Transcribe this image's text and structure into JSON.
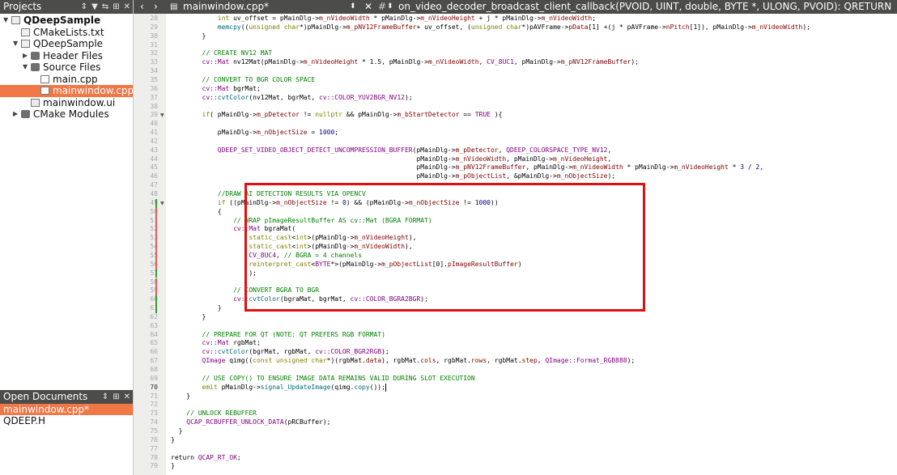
{
  "sidebar": {
    "header": "Projects",
    "tree": [
      {
        "label": "QDeepSample",
        "depth": 0,
        "icon": "project-icon",
        "arrow": "down",
        "bold": true
      },
      {
        "label": "CMakeLists.txt",
        "depth": 1,
        "icon": "file-icon",
        "arrow": "",
        "bold": false
      },
      {
        "label": "QDeepSample",
        "depth": 1,
        "icon": "hammer-icon",
        "arrow": "down",
        "bold": false
      },
      {
        "label": "Header Files",
        "depth": 2,
        "icon": "folder-icon",
        "arrow": "right",
        "bold": false
      },
      {
        "label": "Source Files",
        "depth": 2,
        "icon": "folder-icon",
        "arrow": "down",
        "bold": false
      },
      {
        "label": "main.cpp",
        "depth": 3,
        "icon": "cpp-file-icon",
        "arrow": "",
        "bold": false
      },
      {
        "label": "mainwindow.cpp",
        "depth": 3,
        "icon": "cpp-file-icon",
        "arrow": "",
        "bold": false,
        "selected": true
      },
      {
        "label": "mainwindow.ui",
        "depth": 2,
        "icon": "ui-file-icon",
        "arrow": "",
        "bold": false
      },
      {
        "label": "CMake Modules",
        "depth": 1,
        "icon": "folder-icon",
        "arrow": "right",
        "bold": false
      }
    ]
  },
  "open_documents": {
    "header": "Open Documents",
    "items": [
      {
        "label": "mainwindow.cpp*",
        "selected": true
      },
      {
        "label": "QDEEP.H",
        "selected": false
      }
    ]
  },
  "editor_toolbar": {
    "file_name": "mainwindow.cpp*",
    "symbol": "on_video_decoder_broadcast_client_callback(PVOID, UINT, double, BYTE *, ULONG, PVOID): QRETURN",
    "hash": "#"
  },
  "editor": {
    "current_line": 70,
    "lines": [
      {
        "n": 28,
        "s": [
          [
            "",
            "            "
          ],
          [
            "k",
            "int"
          ],
          [
            "",
            " uv_offset = pMainDlg->"
          ],
          [
            "m",
            "m_nVideoWidth"
          ],
          [
            "",
            " * pMainDlg->"
          ],
          [
            "m",
            "m_nVideoHeight"
          ],
          [
            "",
            " + j * pMainDlg->"
          ],
          [
            "m",
            "m_nVideoWidth"
          ],
          [
            "",
            ";"
          ]
        ]
      },
      {
        "n": 29,
        "s": [
          [
            "",
            "            "
          ],
          [
            "f",
            "memcpy"
          ],
          [
            "",
            "(("
          ],
          [
            "k",
            "unsigned char"
          ],
          [
            "",
            "*)pMainDlg->"
          ],
          [
            "m",
            "m_pNV12FrameBuffer"
          ],
          [
            "",
            "+ uv_offset, ("
          ],
          [
            "k",
            "unsigned char"
          ],
          [
            "",
            "*)pAVFrame->"
          ],
          [
            "m",
            "pData"
          ],
          [
            "",
            "[1] +(j * pAVFrame->"
          ],
          [
            "m",
            "nPitch"
          ],
          [
            "",
            "[1]), pMainDlg->"
          ],
          [
            "m",
            "m_nVideoWidth"
          ],
          [
            "",
            ");"
          ]
        ]
      },
      {
        "n": 30,
        "s": [
          [
            "",
            "        }"
          ]
        ]
      },
      {
        "n": 31,
        "s": []
      },
      {
        "n": 32,
        "s": [
          [
            "c",
            "        // CREATE NV12 MAT"
          ]
        ]
      },
      {
        "n": 33,
        "s": [
          [
            "",
            "        "
          ],
          [
            "t",
            "cv::Mat"
          ],
          [
            "",
            " nv12Mat(pMainDlg->"
          ],
          [
            "m",
            "m_nVideoHeight"
          ],
          [
            "",
            " * 1.5, pMainDlg->"
          ],
          [
            "m",
            "m_nVideoWidth"
          ],
          [
            "",
            ", "
          ],
          [
            "e",
            "CV_8UC1"
          ],
          [
            "",
            ", pMainDlg->"
          ],
          [
            "m",
            "m_pNV12FrameBuffer"
          ],
          [
            "",
            ");"
          ]
        ]
      },
      {
        "n": 34,
        "s": []
      },
      {
        "n": 35,
        "s": [
          [
            "c",
            "        // CONVERT TO BGR COLOR SPACE"
          ]
        ]
      },
      {
        "n": 36,
        "s": [
          [
            "",
            "        "
          ],
          [
            "t",
            "cv::Mat"
          ],
          [
            "",
            " bgrMat;"
          ]
        ]
      },
      {
        "n": 37,
        "s": [
          [
            "",
            "        "
          ],
          [
            "t",
            "cv::"
          ],
          [
            "f",
            "cvtColor"
          ],
          [
            "",
            "(nv12Mat, bgrMat, "
          ],
          [
            "t",
            "cv::"
          ],
          [
            "e",
            "COLOR_YUV2BGR_NV12"
          ],
          [
            "",
            ");"
          ]
        ]
      },
      {
        "n": 38,
        "s": []
      },
      {
        "n": 39,
        "s": [
          [
            "",
            "        "
          ],
          [
            "k",
            "if"
          ],
          [
            "",
            "( pMainDlg->"
          ],
          [
            "m",
            "m_pDetector"
          ],
          [
            "",
            " != "
          ],
          [
            "k",
            "nullptr"
          ],
          [
            "",
            " && pMainDlg->"
          ],
          [
            "m",
            "m_bStartDetector"
          ],
          [
            "",
            " == "
          ],
          [
            "e",
            "TRUE"
          ],
          [
            "",
            " ){"
          ]
        ],
        "fold": true
      },
      {
        "n": 40,
        "s": []
      },
      {
        "n": 41,
        "s": [
          [
            "",
            "            pMainDlg->"
          ],
          [
            "m",
            "m_nObjectSize"
          ],
          [
            "",
            " = "
          ],
          [
            "n",
            "1000"
          ],
          [
            "",
            ";"
          ]
        ]
      },
      {
        "n": 42,
        "s": []
      },
      {
        "n": 43,
        "s": [
          [
            "",
            "            "
          ],
          [
            "e",
            "QDEEP_SET_VIDEO_OBJECT_DETECT_UNCOMPRESSION_BUFFER"
          ],
          [
            "",
            "(pMainDlg->"
          ],
          [
            "m",
            "m_pDetector"
          ],
          [
            "",
            ", "
          ],
          [
            "e",
            "QDEEP_COLORSPACE_TYPE_NV12"
          ],
          [
            "",
            ","
          ]
        ]
      },
      {
        "n": 44,
        "s": [
          [
            "",
            "                                                               pMainDlg->"
          ],
          [
            "m",
            "m_nVideoWidth"
          ],
          [
            "",
            ", pMainDlg->"
          ],
          [
            "m",
            "m_nVideoHeight"
          ],
          [
            "",
            ","
          ]
        ]
      },
      {
        "n": 45,
        "s": [
          [
            "",
            "                                                               pMainDlg->"
          ],
          [
            "m",
            "m_pNV12FrameBuffer"
          ],
          [
            "",
            ", pMainDlg->"
          ],
          [
            "m",
            "m_nVideoWidth"
          ],
          [
            "",
            " * pMainDlg->"
          ],
          [
            "m",
            "m_nVideoHeight"
          ],
          [
            "",
            " * "
          ],
          [
            "n",
            "3"
          ],
          [
            "",
            " / "
          ],
          [
            "n",
            "2"
          ],
          [
            "",
            ","
          ]
        ]
      },
      {
        "n": 46,
        "s": [
          [
            "",
            "                                                               pMainDlg->"
          ],
          [
            "m",
            "m_pObjectList"
          ],
          [
            "",
            ", &pMainDlg->"
          ],
          [
            "m",
            "m_nObjectSize"
          ],
          [
            "",
            ");"
          ]
        ]
      },
      {
        "n": 47,
        "s": []
      },
      {
        "n": 48,
        "s": [
          [
            "c",
            "            //DRAW AI DETECTION RESULTS VIA OPENCV"
          ]
        ]
      },
      {
        "n": 49,
        "s": [
          [
            "",
            "            "
          ],
          [
            "k",
            "if"
          ],
          [
            "",
            " ((pMainDlg->"
          ],
          [
            "m",
            "m_nObjectSize"
          ],
          [
            "",
            " != "
          ],
          [
            "n",
            "0"
          ],
          [
            "",
            ") && (pMainDlg->"
          ],
          [
            "m",
            "m_nObjectSize"
          ],
          [
            "",
            " != "
          ],
          [
            "n",
            "1000"
          ],
          [
            "",
            "))"
          ]
        ],
        "fold": true
      },
      {
        "n": 50,
        "s": [
          [
            "",
            "            {"
          ]
        ]
      },
      {
        "n": 51,
        "s": [
          [
            "c",
            "                // WRAP pImageResultBuffer AS cv::Mat (BGRA FORMAT)"
          ]
        ]
      },
      {
        "n": 52,
        "s": [
          [
            "",
            "                "
          ],
          [
            "t",
            "cv::Mat"
          ],
          [
            "",
            " bgraMat("
          ]
        ]
      },
      {
        "n": 53,
        "s": [
          [
            "",
            "                    "
          ],
          [
            "k",
            "static_cast"
          ],
          [
            "",
            "<"
          ],
          [
            "k",
            "int"
          ],
          [
            "",
            ">(pMainDlg->"
          ],
          [
            "m",
            "m_nVideoHeight"
          ],
          [
            "",
            "),"
          ]
        ]
      },
      {
        "n": 54,
        "s": [
          [
            "",
            "                    "
          ],
          [
            "k",
            "static_cast"
          ],
          [
            "",
            "<"
          ],
          [
            "k",
            "int"
          ],
          [
            "",
            ">(pMainDlg->"
          ],
          [
            "m",
            "m_nVideoWidth"
          ],
          [
            "",
            "),"
          ]
        ]
      },
      {
        "n": 55,
        "s": [
          [
            "",
            "                    "
          ],
          [
            "e",
            "CV_8UC4"
          ],
          [
            "",
            ", "
          ],
          [
            "c",
            "// BGRA = 4 channels"
          ]
        ]
      },
      {
        "n": 56,
        "s": [
          [
            "",
            "                    "
          ],
          [
            "k",
            "reinterpret_cast"
          ],
          [
            "",
            "<"
          ],
          [
            "t",
            "BYTE"
          ],
          [
            "",
            "*>(pMainDlg->"
          ],
          [
            "m",
            "m_pObjectList"
          ],
          [
            "",
            "[0]."
          ],
          [
            "m",
            "pImageResultBuffer"
          ],
          [
            "",
            ")"
          ]
        ]
      },
      {
        "n": 57,
        "s": [
          [
            "",
            "                    );"
          ]
        ]
      },
      {
        "n": 58,
        "s": []
      },
      {
        "n": 59,
        "s": [
          [
            "c",
            "                // CONVERT BGRA TO BGR"
          ]
        ]
      },
      {
        "n": 60,
        "s": [
          [
            "",
            "                "
          ],
          [
            "t",
            "cv::"
          ],
          [
            "f",
            "cvtColor"
          ],
          [
            "",
            "(bgraMat, bgrMat, "
          ],
          [
            "t",
            "cv::"
          ],
          [
            "e",
            "COLOR_BGRA2BGR"
          ],
          [
            "",
            ");"
          ]
        ]
      },
      {
        "n": 61,
        "s": [
          [
            "",
            "            }"
          ]
        ]
      },
      {
        "n": 62,
        "s": [
          [
            "",
            "        }"
          ]
        ]
      },
      {
        "n": 63,
        "s": []
      },
      {
        "n": 64,
        "s": [
          [
            "c",
            "        // PREPARE FOR QT (NOTE: QT PREFERS RGB FORMAT)"
          ]
        ]
      },
      {
        "n": 65,
        "s": [
          [
            "",
            "        "
          ],
          [
            "t",
            "cv::Mat"
          ],
          [
            "",
            " rgbMat;"
          ]
        ]
      },
      {
        "n": 66,
        "s": [
          [
            "",
            "        "
          ],
          [
            "t",
            "cv::"
          ],
          [
            "f",
            "cvtColor"
          ],
          [
            "",
            "(bgrMat, rgbMat, "
          ],
          [
            "t",
            "cv::"
          ],
          [
            "e",
            "COLOR_BGR2RGB"
          ],
          [
            "",
            ");"
          ]
        ]
      },
      {
        "n": 67,
        "s": [
          [
            "",
            "        "
          ],
          [
            "t",
            "QImage"
          ],
          [
            "",
            " qimg(("
          ],
          [
            "k",
            "const unsigned char"
          ],
          [
            "",
            "*)(rgbMat."
          ],
          [
            "m",
            "data"
          ],
          [
            "",
            "), rgbMat."
          ],
          [
            "m",
            "cols"
          ],
          [
            "",
            ", rgbMat."
          ],
          [
            "m",
            "rows"
          ],
          [
            "",
            ", rgbMat."
          ],
          [
            "m",
            "step"
          ],
          [
            "",
            ", "
          ],
          [
            "t",
            "QImage::"
          ],
          [
            "e",
            "Format_RGB888"
          ],
          [
            "",
            ");"
          ]
        ]
      },
      {
        "n": 68,
        "s": []
      },
      {
        "n": 69,
        "s": [
          [
            "c",
            "        // USE COPY() TO ENSURE IMAGE DATA REMAINS VALID DURING SLOT EXECUTION"
          ]
        ]
      },
      {
        "n": 70,
        "s": [
          [
            "",
            "        "
          ],
          [
            "k",
            "emit"
          ],
          [
            "",
            " pMainDlg->"
          ],
          [
            "f",
            "signal_UpdateImage"
          ],
          [
            "",
            "(qimg."
          ],
          [
            "f",
            "copy"
          ],
          [
            "",
            "());"
          ]
        ]
      },
      {
        "n": 71,
        "s": [
          [
            "",
            "    }"
          ]
        ]
      },
      {
        "n": 72,
        "s": []
      },
      {
        "n": 73,
        "s": [
          [
            "c",
            "    // UNLOCK REBUFFER"
          ]
        ]
      },
      {
        "n": 74,
        "s": [
          [
            "",
            "    "
          ],
          [
            "e",
            "QCAP_RCBUFFER_UNLOCK_DATA"
          ],
          [
            "",
            "(pRCBuffer);"
          ]
        ]
      },
      {
        "n": 75,
        "s": [
          [
            "",
            "  }"
          ]
        ]
      },
      {
        "n": 76,
        "s": [
          [
            "",
            "}"
          ]
        ]
      },
      {
        "n": 77,
        "s": []
      },
      {
        "n": 78,
        "s": [
          [
            "",
            "return "
          ],
          [
            "e",
            "QCAP_RT_OK"
          ],
          [
            "",
            ";"
          ]
        ]
      },
      {
        "n": 79,
        "s": [
          [
            "",
            "}"
          ]
        ]
      }
    ]
  }
}
